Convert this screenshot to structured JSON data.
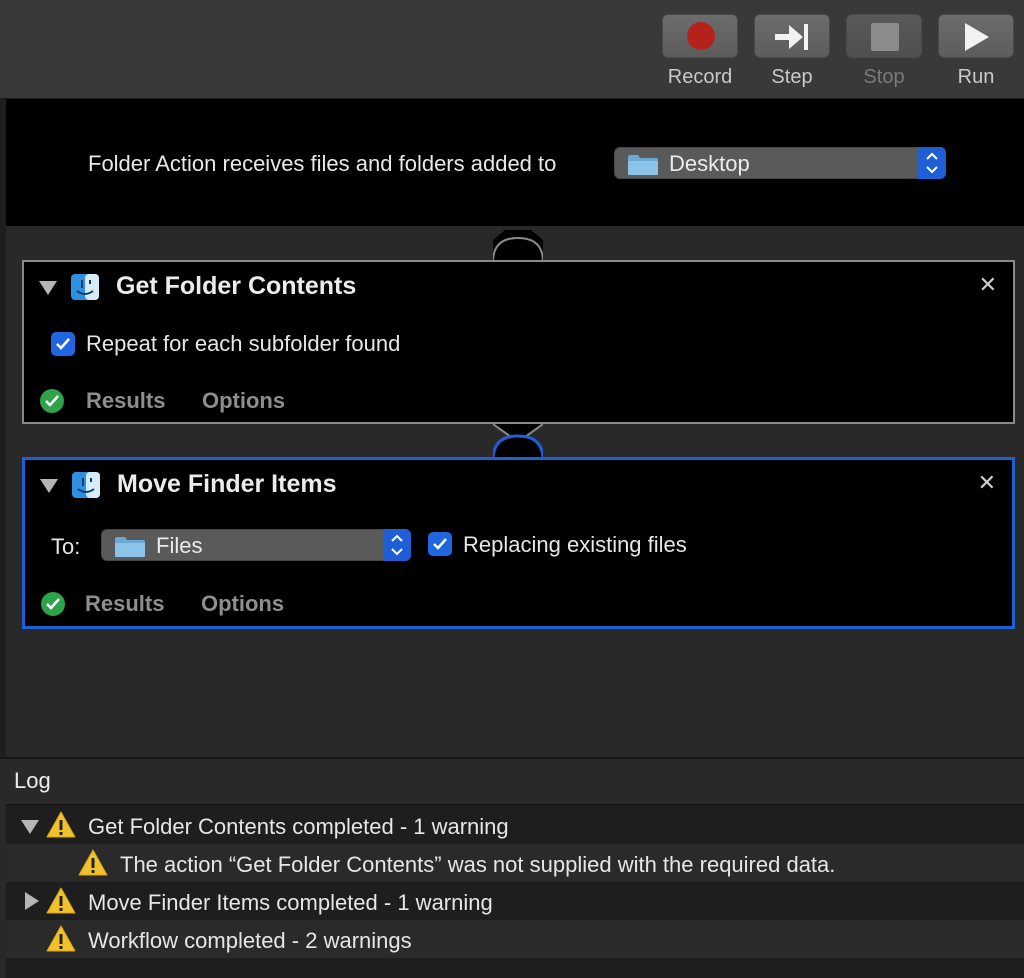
{
  "toolbar": {
    "record_label": "Record",
    "step_label": "Step",
    "stop_label": "Stop",
    "run_label": "Run"
  },
  "workflow": {
    "receives_label": "Folder Action receives files and folders added to",
    "folder_value": "Desktop"
  },
  "actions": [
    {
      "title": "Get Folder Contents",
      "checkbox_label": "Repeat for each subfolder found",
      "results_label": "Results",
      "options_label": "Options",
      "close_glyph": "✕"
    },
    {
      "title": "Move Finder Items",
      "to_label": "To:",
      "to_value": "Files",
      "checkbox_label": "Replacing existing files",
      "results_label": "Results",
      "options_label": "Options",
      "close_glyph": "✕"
    }
  ],
  "log": {
    "title": "Log",
    "entries": [
      "Get Folder Contents completed - 1 warning",
      "The action “Get Folder Contents” was not supplied with the required data.",
      "Move Finder Items completed - 1 warning",
      "Workflow completed - 2 warnings"
    ]
  },
  "colors": {
    "accent": "#1f5fd6",
    "record": "#b3231c",
    "success": "#2fa34a",
    "warning": "#f2c12e"
  }
}
